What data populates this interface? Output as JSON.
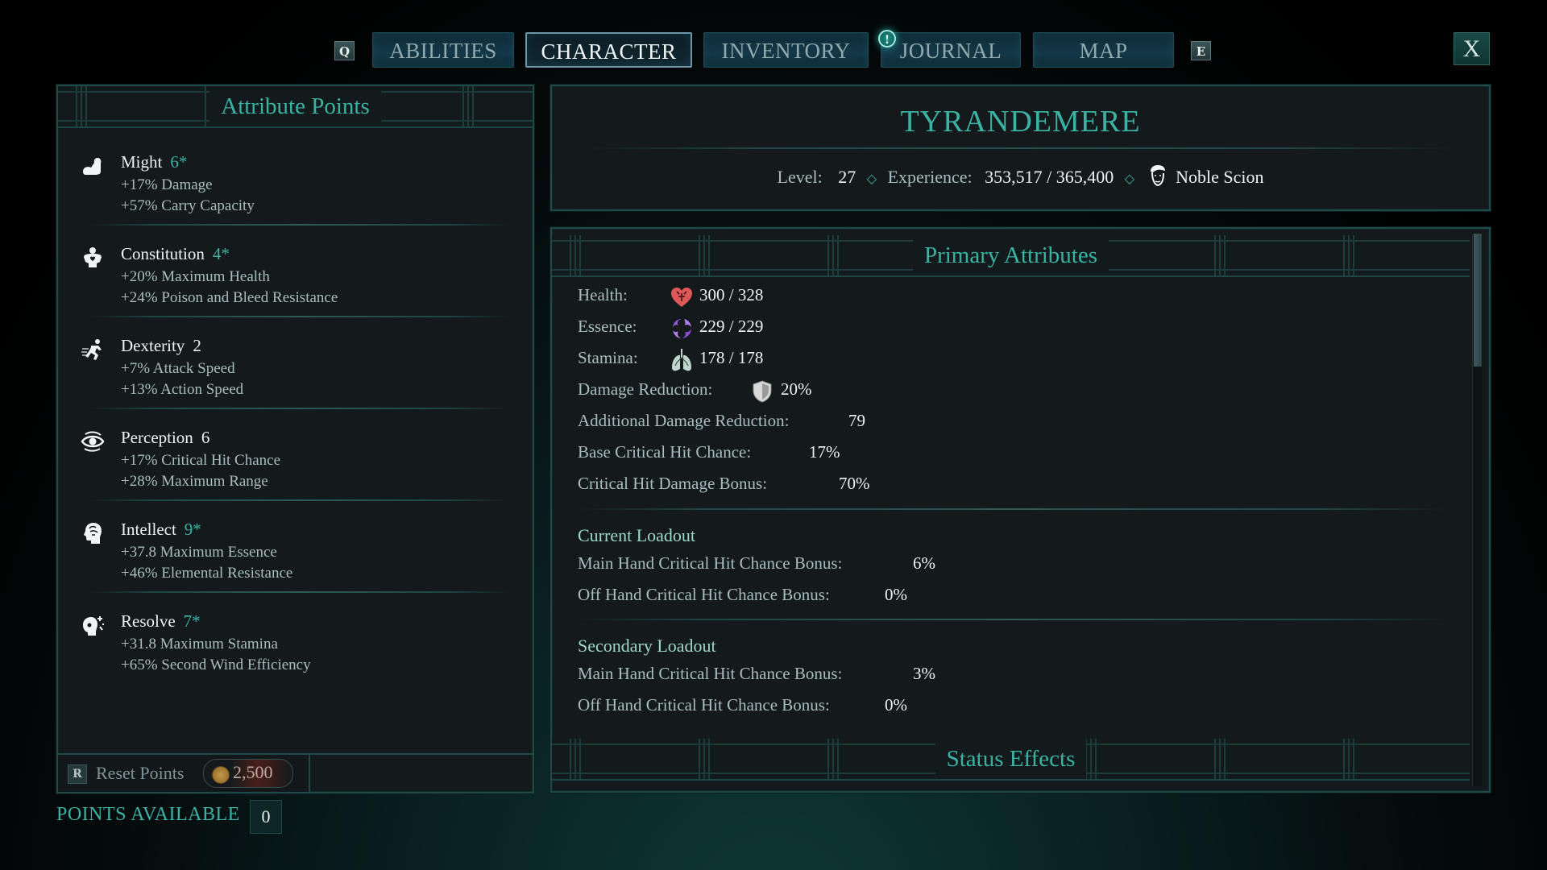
{
  "nav": {
    "prev_key": "Q",
    "next_key": "E",
    "tabs": [
      {
        "label": "ABILITIES",
        "active": false
      },
      {
        "label": "CHARACTER",
        "active": true
      },
      {
        "label": "INVENTORY",
        "active": false
      },
      {
        "label": "JOURNAL",
        "active": false,
        "notification": "!"
      },
      {
        "label": "MAP",
        "active": false
      }
    ],
    "close_label": "X"
  },
  "attributes_panel": {
    "title": "Attribute Points",
    "attributes": [
      {
        "name": "Might",
        "value": "6*",
        "boosted": true,
        "icon": "flexed-arm-icon",
        "bonuses": [
          "+17% Damage",
          "+57% Carry Capacity"
        ]
      },
      {
        "name": "Constitution",
        "value": "4*",
        "boosted": true,
        "icon": "heart-torso-icon",
        "bonuses": [
          "+20% Maximum Health",
          "+24% Poison and Bleed Resistance"
        ]
      },
      {
        "name": "Dexterity",
        "value": "2",
        "boosted": false,
        "icon": "running-figure-icon",
        "bonuses": [
          "+7% Attack Speed",
          "+13% Action Speed"
        ]
      },
      {
        "name": "Perception",
        "value": "6",
        "boosted": false,
        "icon": "eye-icon",
        "bonuses": [
          "+17% Critical Hit Chance",
          "+28% Maximum Range"
        ]
      },
      {
        "name": "Intellect",
        "value": "9*",
        "boosted": true,
        "icon": "brain-head-icon",
        "bonuses": [
          "+37.8 Maximum Essence",
          "+46% Elemental Resistance"
        ]
      },
      {
        "name": "Resolve",
        "value": "7*",
        "boosted": true,
        "icon": "resolve-head-icon",
        "bonuses": [
          "+31.8 Maximum Stamina",
          "+65% Second Wind Efficiency"
        ]
      }
    ],
    "reset": {
      "key": "R",
      "label": "Reset Points",
      "cost": "2,500",
      "currency_icon": "gold-coin-icon"
    },
    "points_available_label": "POINTS AVAILABLE",
    "points_available": "0"
  },
  "character": {
    "name": "TYRANDEMERE",
    "level_label": "Level:",
    "level": "27",
    "experience_label": "Experience:",
    "experience": "353,517 / 365,400",
    "background_icon": "noble-portrait-icon",
    "background": "Noble Scion"
  },
  "primary_attributes": {
    "title": "Primary Attributes",
    "stats": [
      {
        "label": "Health:",
        "icon": "heart-icon",
        "icon_color": "#e0575a",
        "value": "300 / 328"
      },
      {
        "label": "Essence:",
        "icon": "essence-swirl-icon",
        "icon_color": "#9a5ae0",
        "value": "229 / 229"
      },
      {
        "label": "Stamina:",
        "icon": "lungs-icon",
        "icon_color": "#bfd6cc",
        "value": "178 / 178"
      },
      {
        "label": "Damage Reduction:",
        "icon": "shield-icon",
        "icon_color": "#d9d9d9",
        "value": "20%"
      },
      {
        "label": "Additional Damage Reduction:",
        "value": "79"
      },
      {
        "label": "Base Critical Hit Chance:",
        "value": "17%"
      },
      {
        "label": "Critical Hit Damage Bonus:",
        "value": "70%"
      }
    ],
    "loadouts": [
      {
        "title": "Current Loadout",
        "rows": [
          {
            "label": "Main Hand Critical Hit Chance Bonus:",
            "value": "6%"
          },
          {
            "label": "Off Hand Critical Hit Chance Bonus:",
            "value": "0%"
          }
        ]
      },
      {
        "title": "Secondary Loadout",
        "rows": [
          {
            "label": "Main Hand Critical Hit Chance Bonus:",
            "value": "3%"
          },
          {
            "label": "Off Hand Critical Hit Chance Bonus:",
            "value": "0%"
          }
        ]
      }
    ],
    "status_effects_title": "Status Effects",
    "scroll_position": 0.0
  },
  "colors": {
    "accent": "#3ab3a5",
    "panel_bg": "#141a1b",
    "border": "#1f4a48"
  }
}
